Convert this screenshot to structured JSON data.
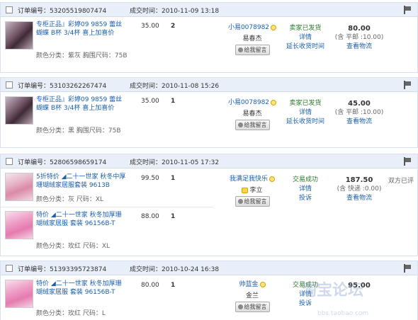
{
  "orders": [
    {
      "order_label": "订单编号：",
      "order_no": "53205519807474",
      "time_label": "成交时间：",
      "time": "2010-11-09 13:18",
      "items": [
        {
          "title": "专柜正品』彩婷09 9859 蕾丝蝴蝶 B杯 3/4杯 喜上加喜价",
          "attrs": "颜色分类：紫灰    胸围尺码：75B",
          "price": "35.00",
          "qty": "2"
        }
      ],
      "buyer_nick": "小易0078982",
      "buyer_name": "易春杰",
      "memo_btn": "给我留言",
      "status_main": "卖家已发货",
      "status_link1": "详情",
      "status_link2": "延长收货时间",
      "total": "80.00",
      "shipping": "(含 平邮 :10.00)",
      "logistics": "查看物流",
      "rate": ""
    },
    {
      "order_label": "订单编号：",
      "order_no": "53103262267474",
      "time_label": "成交时间：",
      "time": "2010-11-08 15:26",
      "items": [
        {
          "title": "专柜正品』彩婷09 9859 蕾丝蝴蝶 B杯 3/4杯 喜上加喜价",
          "attrs": "颜色分类：黑    胸围尺码：75B",
          "price": "35.00",
          "qty": "1"
        }
      ],
      "buyer_nick": "小易0078982",
      "buyer_name": "易春杰",
      "memo_btn": "给我留言",
      "status_main": "卖家已发货",
      "status_link1": "详情",
      "status_link2": "延长收货时间",
      "total": "45.00",
      "shipping": "(含 平邮 :10.00)",
      "logistics": "查看物流",
      "rate": ""
    },
    {
      "order_label": "订单编号：",
      "order_no": "52806598659174",
      "time_label": "成交时间：",
      "time": "2010-11-05 17:32",
      "items": [
        {
          "title": "5折特价 ◢二十一世家 秋冬中厚珊瑚绒家居服套装 9613B",
          "attrs": "颜色分类：灰    尺码：XL",
          "price": "99.50",
          "qty": "1"
        },
        {
          "title": "特价 ◢二十一世家 秋冬加厚珊瑚绒家居服 套装 96156B-T",
          "attrs": "颜色分类：玫红    尺码：XL",
          "price": "88.00",
          "qty": "1"
        }
      ],
      "buyer_nick": "我满足我快乐",
      "buyer_name": "李立",
      "memo_btn": "给我留言",
      "status_main": "交易成功",
      "status_link1": "详情",
      "status_link2": "投诉",
      "total": "187.50",
      "shipping": "(含 快递 :0.00)",
      "logistics": "查看物流",
      "rate": "双方已评"
    },
    {
      "order_label": "订单编号：",
      "order_no": "51393395723874",
      "time_label": "成交时间：",
      "time": "2010-10-24 16:38",
      "items": [
        {
          "title": "特价 ◢二十一世家 秋冬加厚珊瑚绒家居服 套装 96156B-T",
          "attrs": "颜色分类：玫红    尺码：L",
          "price": "80.00",
          "qty": "1"
        }
      ],
      "buyer_nick": "帅蓝金",
      "buyer_name": "金兰",
      "memo_btn": "给我留言",
      "status_main": "交易成功",
      "status_link1": "详情",
      "status_link2": "投诉",
      "total": "95.00",
      "shipping": "",
      "logistics": "",
      "rate": ""
    }
  ],
  "watermark": {
    "big": "淘宝论坛",
    "small": "bbs.taobao.com"
  }
}
